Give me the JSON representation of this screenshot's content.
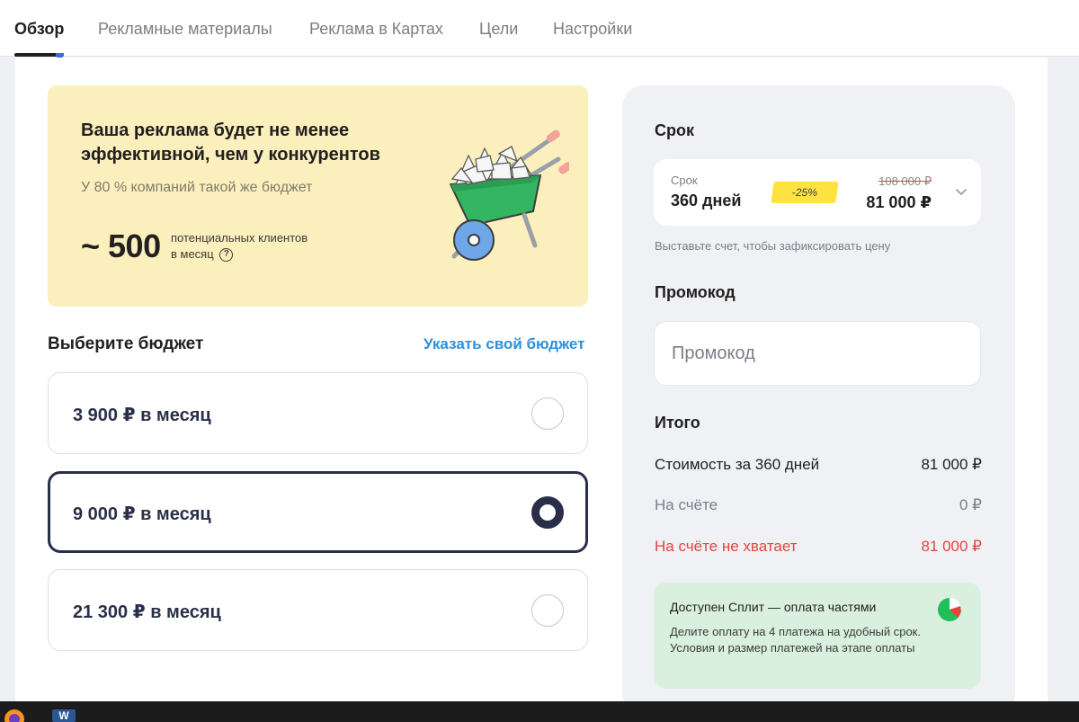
{
  "nav": {
    "tabs": [
      {
        "label": "Обзор",
        "active": true
      },
      {
        "label": "Рекламные материалы",
        "active": false
      },
      {
        "label": "Реклама в Картах",
        "active": false
      },
      {
        "label": "Цели",
        "active": false
      },
      {
        "label": "Настройки",
        "active": false
      }
    ]
  },
  "promo": {
    "title": "Ваша реклама будет не менее эффективной, чем у конкурентов",
    "subtitle": "У 80 % компаний такой же бюджет",
    "reach_value": "~ 500",
    "reach_caption_line1": "потенциальных клиентов",
    "reach_caption_line2": "в месяц",
    "help_glyph": "?"
  },
  "budget": {
    "title": "Выберите бюджет",
    "custom_link": "Указать свой бюджет",
    "options": [
      {
        "label": "3 900 ₽ в месяц",
        "selected": false
      },
      {
        "label": "9 000 ₽ в месяц",
        "selected": true
      },
      {
        "label": "21 300 ₽ в месяц",
        "selected": false
      }
    ]
  },
  "sidebar": {
    "term_heading": "Срок",
    "term": {
      "label": "Срок",
      "value": "360 дней",
      "discount": "-25%",
      "old_price": "108 000 ₽",
      "new_price": "81 000 ₽"
    },
    "term_hint": "Выставьте счет, чтобы зафиксировать цену",
    "promo_heading": "Промокод",
    "promo_placeholder": "Промокод",
    "total_heading": "Итого",
    "rows": [
      {
        "label": "Стоимость за 360 дней",
        "value": "81 000 ₽"
      },
      {
        "label": "На счёте",
        "value": "0 ₽"
      },
      {
        "label": "На счёте не хватает",
        "value": "81 000 ₽"
      }
    ],
    "split": {
      "title": "Доступен Сплит — оплата частями",
      "text": "Делите оплату на 4 платежа на удобный срок. Условия и размер платежей на этапе оплаты"
    }
  },
  "taskbar": {
    "word_glyph": "W"
  },
  "colors": {
    "accent_link": "#2e8fdd",
    "promo_bg": "#fcefbe",
    "selected_border": "#2a2f49",
    "deficit": "#e0473d",
    "split_bg": "#d9f0df",
    "discount_badge": "#fde242"
  }
}
